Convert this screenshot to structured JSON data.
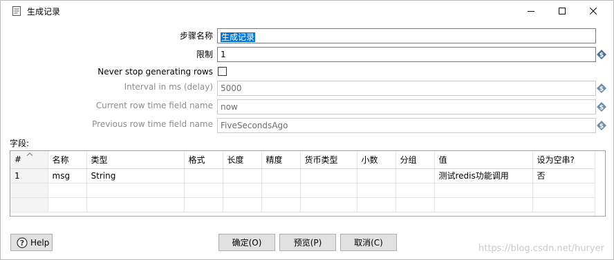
{
  "window": {
    "title": "生成记录",
    "controls": {
      "minimize": "minimize",
      "maximize": "maximize",
      "close": "close"
    }
  },
  "form": {
    "step_name": {
      "label": "步骤名称",
      "value": "生成记录"
    },
    "limit": {
      "label": "限制",
      "value": "1"
    },
    "never_stop": {
      "label": "Never stop generating rows",
      "checked": false
    },
    "interval": {
      "label": "Interval in ms (delay)",
      "value": "5000"
    },
    "current_row_time": {
      "label": "Current row time field name",
      "value": "now"
    },
    "previous_row_time": {
      "label": "Previous row time field name",
      "value": "FiveSecondsAgo"
    }
  },
  "fields": {
    "section_label": "字段:",
    "columns": [
      "#",
      "名称",
      "类型",
      "格式",
      "长度",
      "精度",
      "货币类型",
      "小数",
      "分组",
      "值",
      "设为空串?"
    ],
    "rows": [
      [
        "1",
        "msg",
        "String",
        "",
        "",
        "",
        "",
        "",
        "",
        "测试redis功能调用",
        "否"
      ]
    ]
  },
  "buttons": {
    "help": "Help",
    "ok": "确定(O)",
    "preview": "预览(P)",
    "cancel": "取消(C)"
  },
  "watermark": "https://blog.csdn.net/huryer",
  "colors": {
    "selection": "#0078d7",
    "button_bg": "#e1e1e1",
    "variable_icon": "#4a6f8f"
  }
}
